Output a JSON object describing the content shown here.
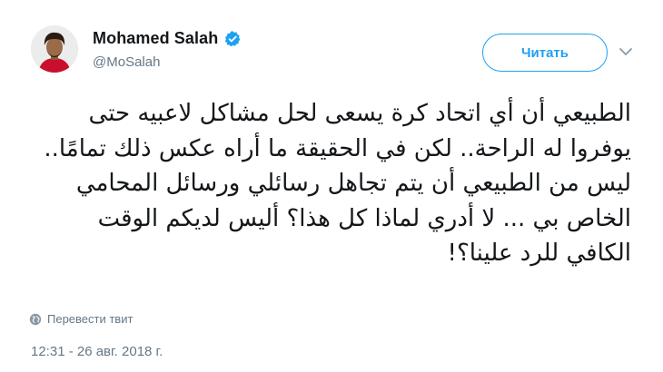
{
  "user": {
    "display_name": "Mohamed Salah",
    "handle": "@MoSalah",
    "verified_icon": "verified-badge-icon",
    "avatar_icon": "avatar-image"
  },
  "actions": {
    "follow_label": "Читать",
    "menu_icon": "chevron-down-icon"
  },
  "tweet": {
    "text": "الطبيعي أن أي اتحاد كرة يسعى لحل مشاكل لاعبيه حتى يوفروا له الراحة.. لكن في الحقيقة ما أراه عكس ذلك تمامًا.. ليس من الطبيعي أن يتم تجاهل رسائلي ورسائل المحامي الخاص بي ... لا أدري لماذا كل هذا؟ أليس لديكم الوقت الكافي للرد علينا؟!",
    "translate_label": "Перевести твит",
    "timestamp": "12:31 - 26 авг. 2018 г."
  },
  "colors": {
    "accent": "#1da1f2",
    "secondary_text": "#657786",
    "primary_text": "#14171a",
    "jersey_red": "#c8102e"
  }
}
